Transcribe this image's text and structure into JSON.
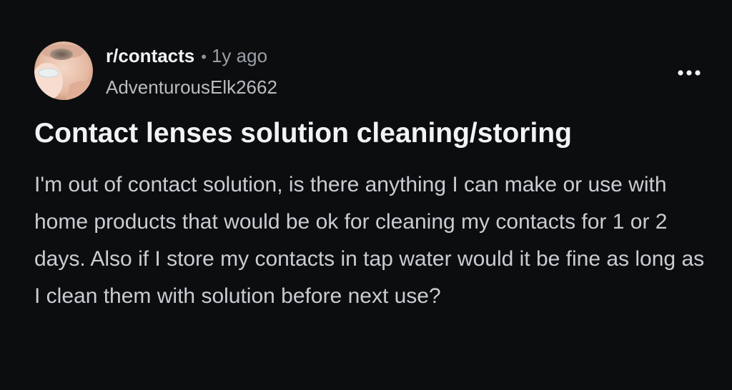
{
  "post": {
    "subreddit": "r/contacts",
    "separator": "•",
    "age": "1y ago",
    "username": "AdventurousElk2662",
    "title": "Contact lenses solution cleaning/storing",
    "body": "I'm out of contact solution, is there anything I can make or use with home products that would be ok for cleaning my contacts for 1 or 2 days. Also if I store my contacts in tap water would it be fine as long as I clean them with solution before next use?"
  },
  "icons": {
    "avatar": "contact-lens-on-fingertip-avatar",
    "more": "more-horizontal-icon"
  },
  "colors": {
    "background": "#0b0d0f",
    "text_primary": "#f2f3f5",
    "text_secondary": "#9aa0a6",
    "text_body": "#c9cdd2"
  }
}
